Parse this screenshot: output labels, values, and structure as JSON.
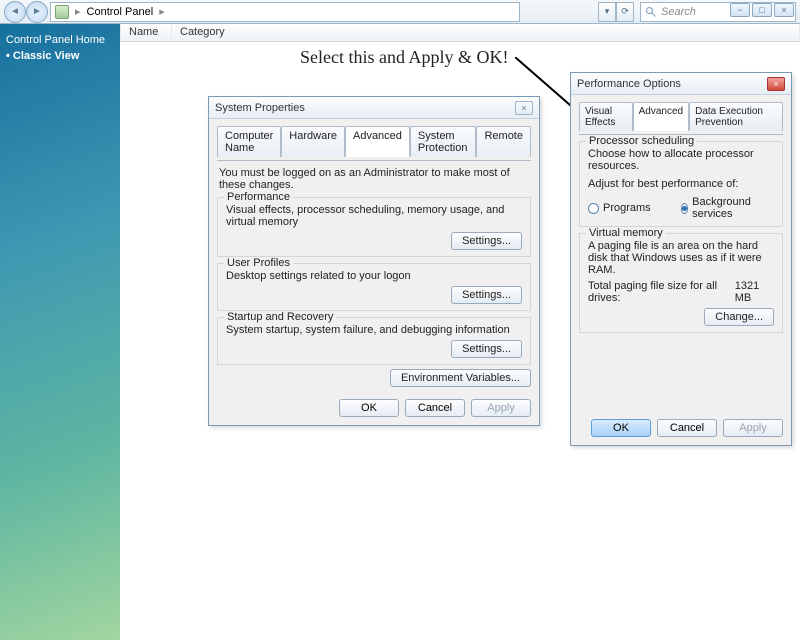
{
  "addrbar": {
    "path_root": "Control Panel",
    "refresh_glyph": "⟳",
    "dropdown_glyph": "▾",
    "search_placeholder": "Search"
  },
  "win_btns": {
    "min": "−",
    "max": "□",
    "close": "×"
  },
  "sidebar": {
    "home": "Control Panel Home",
    "classic": "Classic View"
  },
  "columns": {
    "name": "Name",
    "category": "Category"
  },
  "annotation": "Select this and Apply & OK!",
  "sysprops": {
    "title": "System Properties",
    "close": "×",
    "tabs": [
      "Computer Name",
      "Hardware",
      "Advanced",
      "System Protection",
      "Remote"
    ],
    "note": "You must be logged on as an Administrator to make most of these changes.",
    "groups": [
      {
        "title": "Performance",
        "desc": "Visual effects, processor scheduling, memory usage, and virtual memory",
        "btn": "Settings..."
      },
      {
        "title": "User Profiles",
        "desc": "Desktop settings related to your logon",
        "btn": "Settings..."
      },
      {
        "title": "Startup and Recovery",
        "desc": "System startup, system failure, and debugging information",
        "btn": "Settings..."
      }
    ],
    "env_btn": "Environment Variables...",
    "ok": "OK",
    "cancel": "Cancel",
    "apply": "Apply"
  },
  "perfopt": {
    "title": "Performance Options",
    "close": "×",
    "tabs": [
      "Visual Effects",
      "Advanced",
      "Data Execution Prevention"
    ],
    "sched": {
      "title": "Processor scheduling",
      "desc": "Choose how to allocate processor resources.",
      "adjust": "Adjust for best performance of:",
      "programs": "Programs",
      "bg": "Background services"
    },
    "vm": {
      "title": "Virtual memory",
      "desc": "A paging file is an area on the hard disk that Windows uses as if it were RAM.",
      "total_label": "Total paging file size for all drives:",
      "total_value": "1321 MB",
      "change": "Change..."
    },
    "ok": "OK",
    "cancel": "Cancel",
    "apply": "Apply"
  }
}
